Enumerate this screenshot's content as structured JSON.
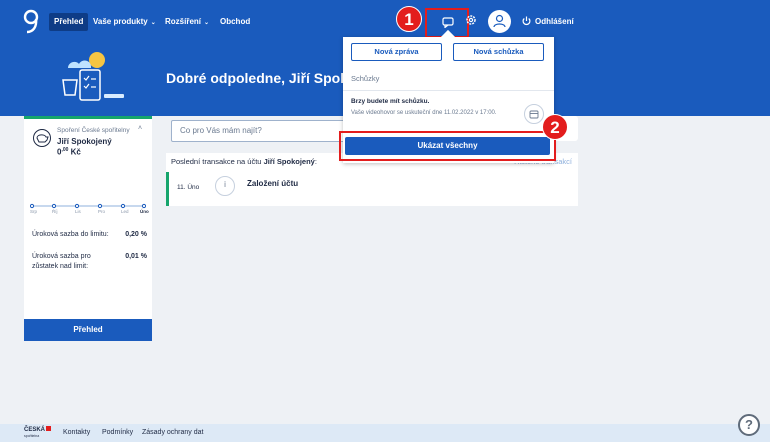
{
  "nav": {
    "items": [
      {
        "label": "Přehled",
        "active": true
      },
      {
        "label": "Vaše produkty",
        "dropdown": true
      },
      {
        "label": "Rozšíření",
        "dropdown": true
      },
      {
        "label": "Obchod",
        "dropdown": false
      }
    ],
    "logout_label": "Odhlášení",
    "icons": [
      "logo-icon",
      "chat-icon",
      "gear-icon",
      "user-icon",
      "power-icon"
    ]
  },
  "annotations": {
    "badge1": "1",
    "badge2": "2"
  },
  "hero": {
    "greeting": "Dobré odpoledne,  Jiří Spokojený!"
  },
  "account": {
    "product": "Spoření České spořitelny",
    "owner": "Jiří Spokojený",
    "balance_main": "0",
    "balance_cents": ",00",
    "currency": "Kč",
    "months": [
      "Srp",
      "Říj",
      "Lis",
      "Pro",
      "Led",
      "Úno"
    ],
    "rates": [
      {
        "label": "Úroková sazba do limitu:",
        "value": "0,20 %"
      },
      {
        "label": "Úroková sazba pro zůstatek nad limit:",
        "value": "0,01 %"
      }
    ],
    "button_label": "Přehled"
  },
  "search": {
    "placeholder": "Co pro Vás mám najít?"
  },
  "transactions": {
    "header_prefix": "Poslední transakce na účtu",
    "header_account": "Jiří Spokojený",
    "header_suffix": ":",
    "history_link": "Historie transakcí",
    "rows": [
      {
        "date": "11. Úno",
        "name": "Založení účtu"
      }
    ]
  },
  "popover": {
    "new_message": "Nová zpráva",
    "new_meeting": "Nová schůzka",
    "section": "Schůzky",
    "meeting_title": "Brzy budete mít schůzku.",
    "meeting_text": "Vaše videohovor se uskuteční dne 11.02.2022 v 17:00.",
    "show_all": "Ukázat všechny"
  },
  "footer": {
    "brand": "ČESKÁ",
    "brand_sub": "spořitelna",
    "links": [
      "Kontakty",
      "Podmínky",
      "Zásady ochrany dat"
    ]
  },
  "colors": {
    "primary": "#1a5bbd",
    "accent_red": "#e31d1d",
    "success": "#16a56c"
  }
}
